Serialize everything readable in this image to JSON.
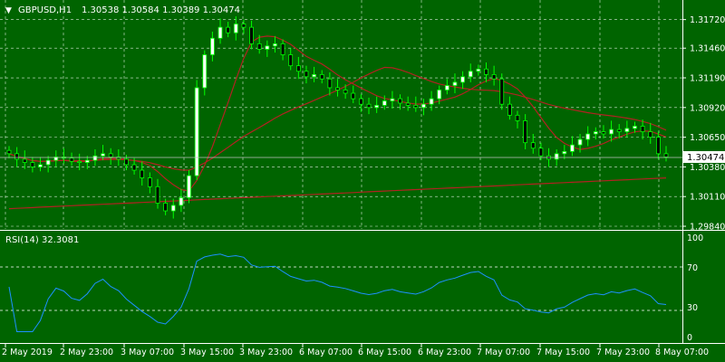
{
  "header": {
    "symbol_label": "GBPUSD,H1",
    "ohlc_label": "1.30538 1.30584 1.30389 1.30474"
  },
  "price_panel": {
    "y_ticks": [
      "1.31720",
      "1.31460",
      "1.31190",
      "1.30920",
      "1.30650",
      "1.30380",
      "1.30110",
      "1.29840"
    ],
    "current_price_label": "1.30474"
  },
  "rsi_panel": {
    "label": "RSI(14) 32.3081",
    "y_ticks": [
      "100",
      "70",
      "30",
      "0"
    ]
  },
  "x_axis": {
    "labels": [
      "2 May 2019",
      "2 May 23:00",
      "3 May 07:00",
      "3 May 15:00",
      "3 May 23:00",
      "6 May 07:00",
      "6 May 15:00",
      "6 May 23:00",
      "7 May 07:00",
      "7 May 15:00",
      "7 May 23:00",
      "8 May 07:00"
    ]
  },
  "colors": {
    "background": "#006400",
    "grid": "#ffffff",
    "candle_up": "#00ff00",
    "candle_down": "#000000",
    "candle_up_body": "#ffffff",
    "ma_line": "#b22222",
    "rsi_line": "#1e90ff",
    "price_line": "#c0c0c0",
    "text": "#ffffff"
  },
  "chart_data": [
    {
      "type": "line",
      "title": "GBPUSD,H1",
      "x_range": [
        "2 May 2019",
        "8 May 07:00"
      ],
      "ylim": [
        1.2984,
        1.3175
      ],
      "current_price": 1.30474,
      "close_approx": [
        1.305,
        1.3045,
        1.3042,
        1.3038,
        1.304,
        1.3044,
        1.3047,
        1.3046,
        1.3043,
        1.3042,
        1.3044,
        1.3048,
        1.305,
        1.3047,
        1.3045,
        1.304,
        1.3035,
        1.3028,
        1.302,
        1.3005,
        1.2998,
        1.3003,
        1.301,
        1.303,
        1.311,
        1.314,
        1.3155,
        1.3165,
        1.316,
        1.3168,
        1.3165,
        1.315,
        1.3145,
        1.3148,
        1.315,
        1.314,
        1.313,
        1.3125,
        1.312,
        1.3122,
        1.3118,
        1.311,
        1.3108,
        1.3105,
        1.31,
        1.3095,
        1.3092,
        1.3094,
        1.3098,
        1.31,
        1.3096,
        1.3094,
        1.3092,
        1.3095,
        1.31,
        1.3108,
        1.3112,
        1.3115,
        1.312,
        1.3125,
        1.3127,
        1.3122,
        1.3118,
        1.3095,
        1.3085,
        1.308,
        1.306,
        1.3055,
        1.3048,
        1.3045,
        1.305,
        1.3052,
        1.3058,
        1.3063,
        1.3068,
        1.307,
        1.3068,
        1.3072,
        1.307,
        1.3073,
        1.3075,
        1.307,
        1.3065,
        1.305,
        1.3047
      ]
    },
    {
      "type": "line",
      "title": "RSI(14) 32.3081",
      "ylim": [
        0,
        100
      ],
      "levels": [
        30,
        70
      ],
      "last_value": 32.3081
    }
  ]
}
